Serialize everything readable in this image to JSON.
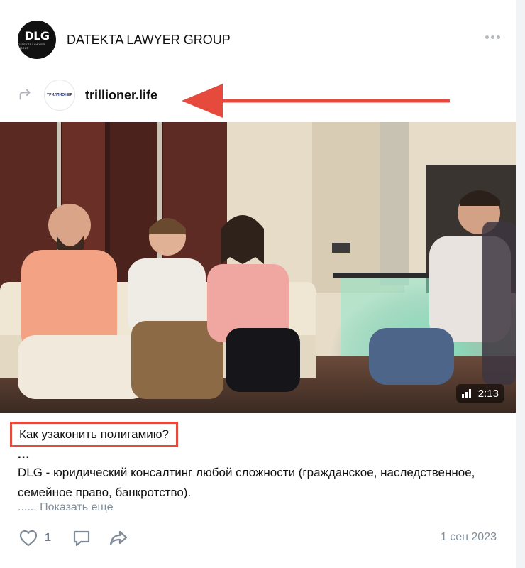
{
  "post": {
    "author": "DATEKTA LAWYER GROUP",
    "author_avatar_text": "DLG",
    "author_avatar_subtext": "DATEKTA LAWYER GROUP",
    "more_icon": "more-dots-icon"
  },
  "repost": {
    "source_name": "trillioner.life",
    "source_avatar_text": "ТРИЛЛИОНЕР",
    "repost_icon": "repost-arrow-icon"
  },
  "video": {
    "duration": "2:13",
    "stats_icon": "bars-icon"
  },
  "content": {
    "question": "Как узаконить полигамию?",
    "dots": "...",
    "description": "DLG - юридический консалтинг любой сложности (гражданское, наследственное, семейное право, банкротство).",
    "show_more_prefix": "......",
    "show_more_label": "Показать ещё"
  },
  "footer": {
    "like_count": "1",
    "date": "1 сен 2023"
  },
  "colors": {
    "annotation_red": "#e54a3c",
    "muted_text": "#818c99",
    "icon_gray": "#b0b4ba"
  }
}
